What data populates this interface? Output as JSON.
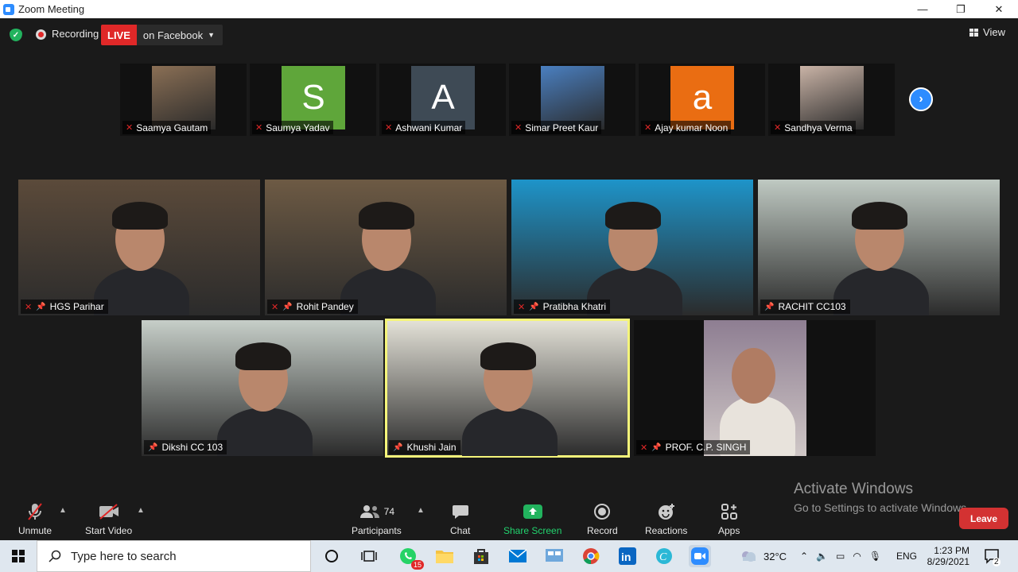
{
  "window": {
    "title": "Zoom Meeting",
    "controls": [
      "—",
      "❐",
      "✕"
    ]
  },
  "topbar": {
    "recording_label": "Recording",
    "live_label": "LIVE",
    "live_destination": "on Facebook",
    "view_label": "View"
  },
  "strip": [
    {
      "name": "Saamya Gautam",
      "avatar_type": "photo",
      "bg": "#8a6f55"
    },
    {
      "name": "Saumya Yadav",
      "avatar_type": "letter",
      "letter": "S",
      "bg": "#5fa63a"
    },
    {
      "name": "Ashwani Kumar",
      "avatar_type": "letter",
      "letter": "A",
      "bg": "#3e4a55"
    },
    {
      "name": "Simar Preet Kaur",
      "avatar_type": "photo",
      "bg": "#4a7fc0"
    },
    {
      "name": "Ajay kumar Noon",
      "avatar_type": "letter",
      "letter": "a",
      "bg": "#ea6d12"
    },
    {
      "name": "Sandhya Verma",
      "avatar_type": "photo",
      "bg": "#c9b3a6"
    }
  ],
  "tiles": [
    {
      "name": "HGS Parihar",
      "muted": true,
      "pinned": true,
      "bg": "#5b4a3a"
    },
    {
      "name": "Rohit Pandey",
      "muted": true,
      "pinned": true,
      "bg": "#6d5a44"
    },
    {
      "name": "Pratibha Khatri",
      "muted": true,
      "pinned": true,
      "bg": "#1e94c9"
    },
    {
      "name": "RACHIT CC103",
      "muted": false,
      "pinned": true,
      "bg": "#bfc9c2"
    },
    {
      "name": "Dikshi CC 103",
      "muted": false,
      "pinned": true,
      "bg": "#c6cec8"
    },
    {
      "name": "Khushi Jain",
      "muted": false,
      "pinned": true,
      "bg": "#e4e2d8",
      "active": true
    },
    {
      "name": "PROF. C.P. SINGH",
      "muted": true,
      "pinned": true,
      "bg": "#7a6d7a"
    }
  ],
  "watermark": {
    "line1": "Activate Windows",
    "line2": "Go to Settings to activate Windows."
  },
  "toolbar": {
    "unmute": "Unmute",
    "start_video": "Start Video",
    "participants": "Participants",
    "participants_count": "74",
    "chat": "Chat",
    "share_screen": "Share Screen",
    "record": "Record",
    "reactions": "Reactions",
    "apps": "Apps",
    "leave": "Leave"
  },
  "taskbar": {
    "search_placeholder": "Type here to search",
    "whatsapp_badge": "15",
    "temperature": "32°C",
    "language": "ENG",
    "time": "1:23 PM",
    "date": "8/29/2021",
    "notification_count": "2"
  },
  "colors": {
    "accent": "#2d8cff",
    "live": "#e02828",
    "share": "#22b35e",
    "leave": "#d33232",
    "active_speaker": "#f5f57a"
  }
}
